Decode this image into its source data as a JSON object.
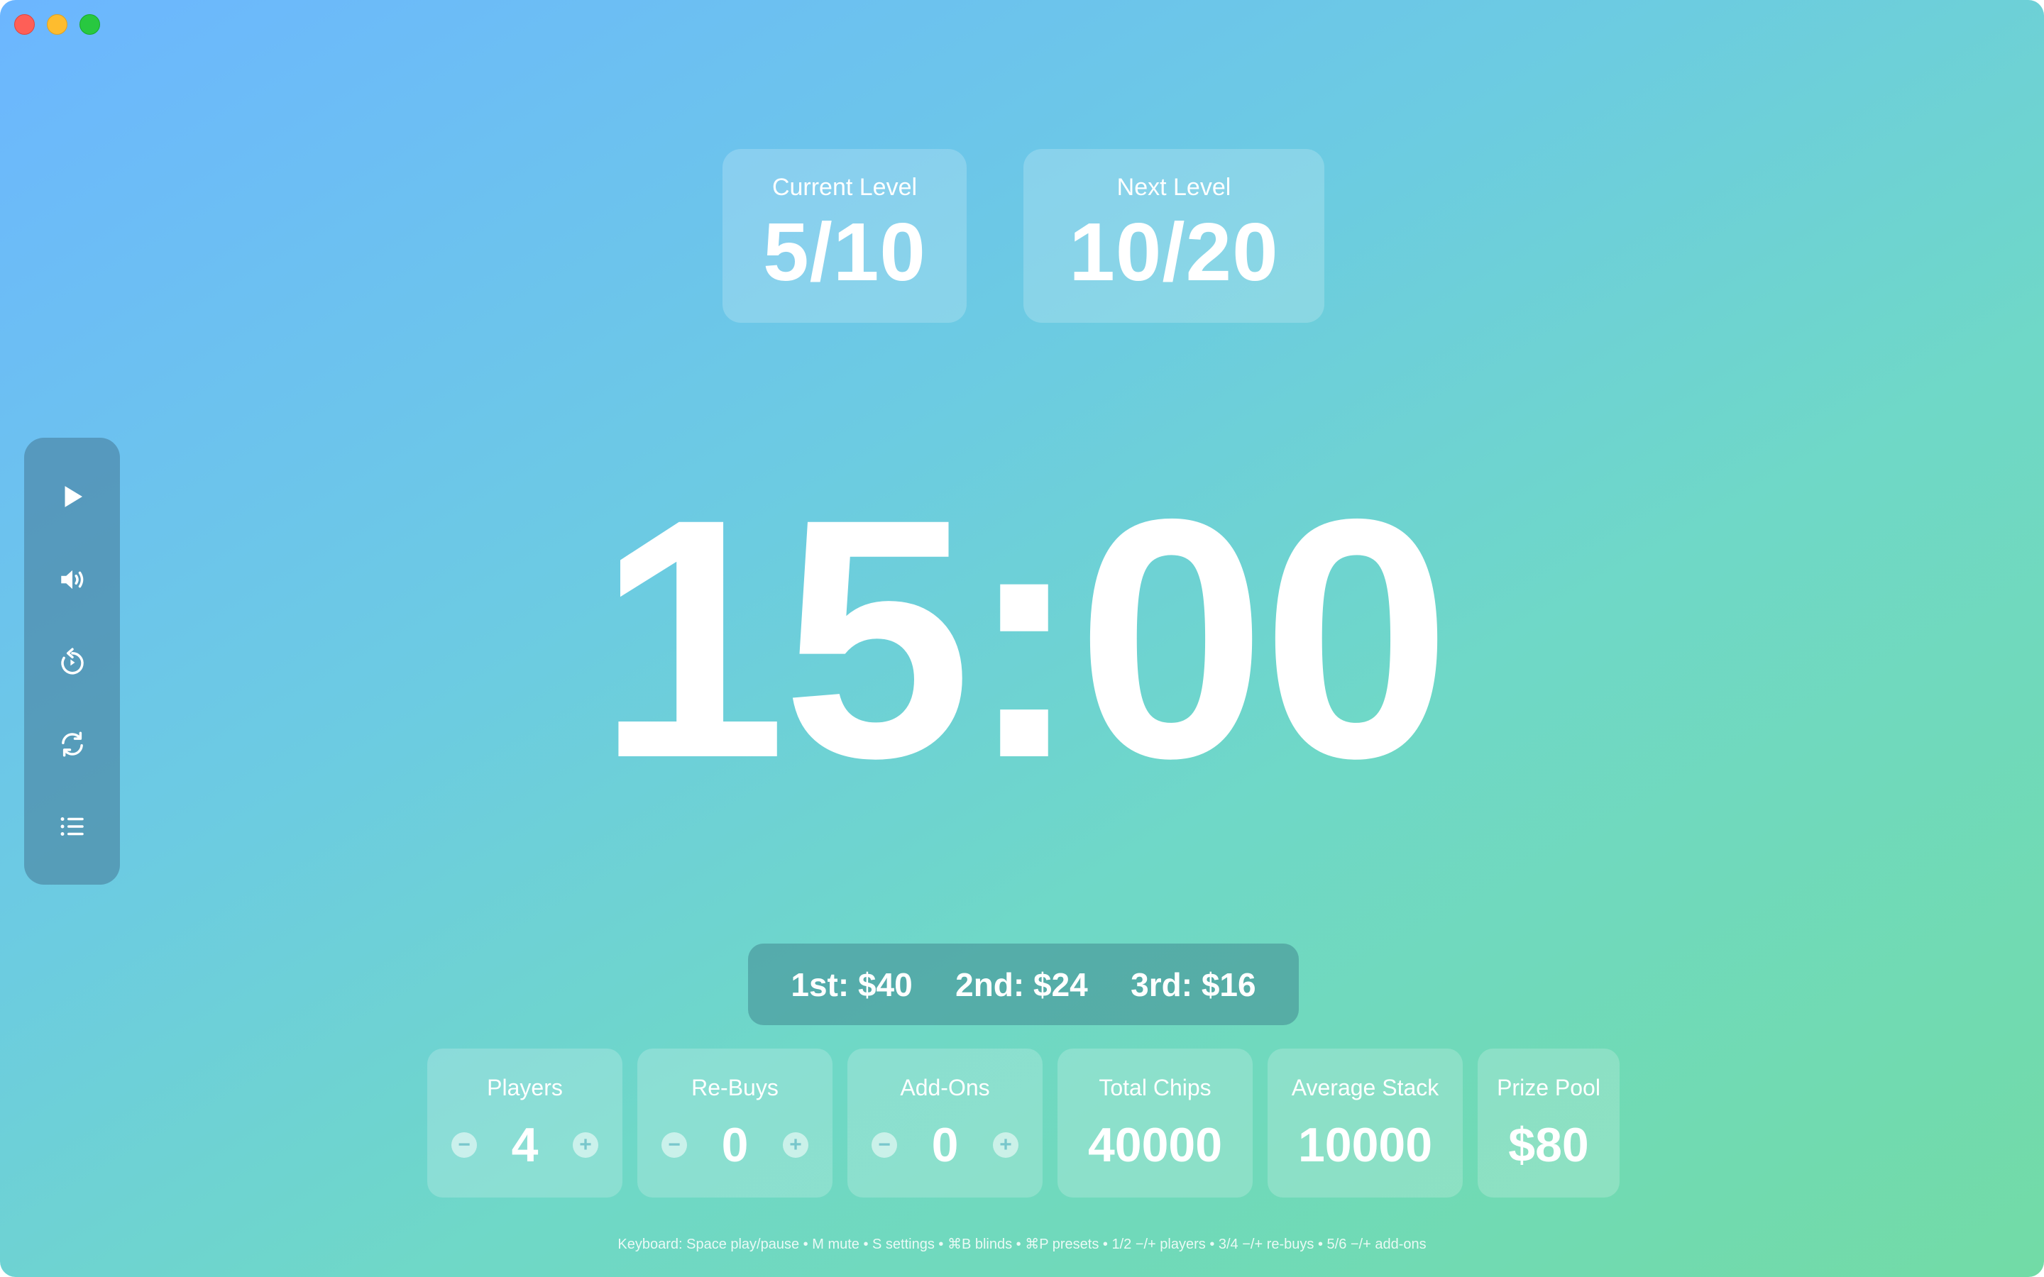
{
  "window": {
    "controls": [
      "close",
      "minimize",
      "zoom"
    ]
  },
  "levels": {
    "current_label": "Current Level",
    "current_value": "5/10",
    "next_label": "Next Level",
    "next_value": "10/20"
  },
  "sidebar": {
    "items": [
      {
        "name": "play",
        "icon": "play-icon"
      },
      {
        "name": "mute",
        "icon": "speaker-icon"
      },
      {
        "name": "reset-timer",
        "icon": "reset-icon"
      },
      {
        "name": "refresh",
        "icon": "refresh-icon"
      },
      {
        "name": "blinds-list",
        "icon": "list-icon"
      }
    ]
  },
  "timer": {
    "display": "15:00"
  },
  "payouts": {
    "first": "1st: $40",
    "second": "2nd: $24",
    "third": "3rd: $16"
  },
  "stats": {
    "players": {
      "label": "Players",
      "value": "4"
    },
    "rebuys": {
      "label": "Re-Buys",
      "value": "0"
    },
    "addons": {
      "label": "Add-Ons",
      "value": "0"
    },
    "total_chips": {
      "label": "Total Chips",
      "value": "40000"
    },
    "average_stack": {
      "label": "Average Stack",
      "value": "10000"
    },
    "prize_pool": {
      "label": "Prize Pool",
      "value": "$80"
    }
  },
  "stepper": {
    "minus": "−",
    "plus": "+"
  },
  "footer": {
    "hint": "Keyboard: Space play/pause • M mute • S settings • ⌘B blinds • ⌘P presets • 1/2 −/+ players • 3/4 −/+ re-buys • 5/6 −/+ add-ons"
  },
  "colors": {
    "gradient_start": "#6cb6ff",
    "gradient_end": "#72dba6",
    "text": "#ffffff"
  }
}
